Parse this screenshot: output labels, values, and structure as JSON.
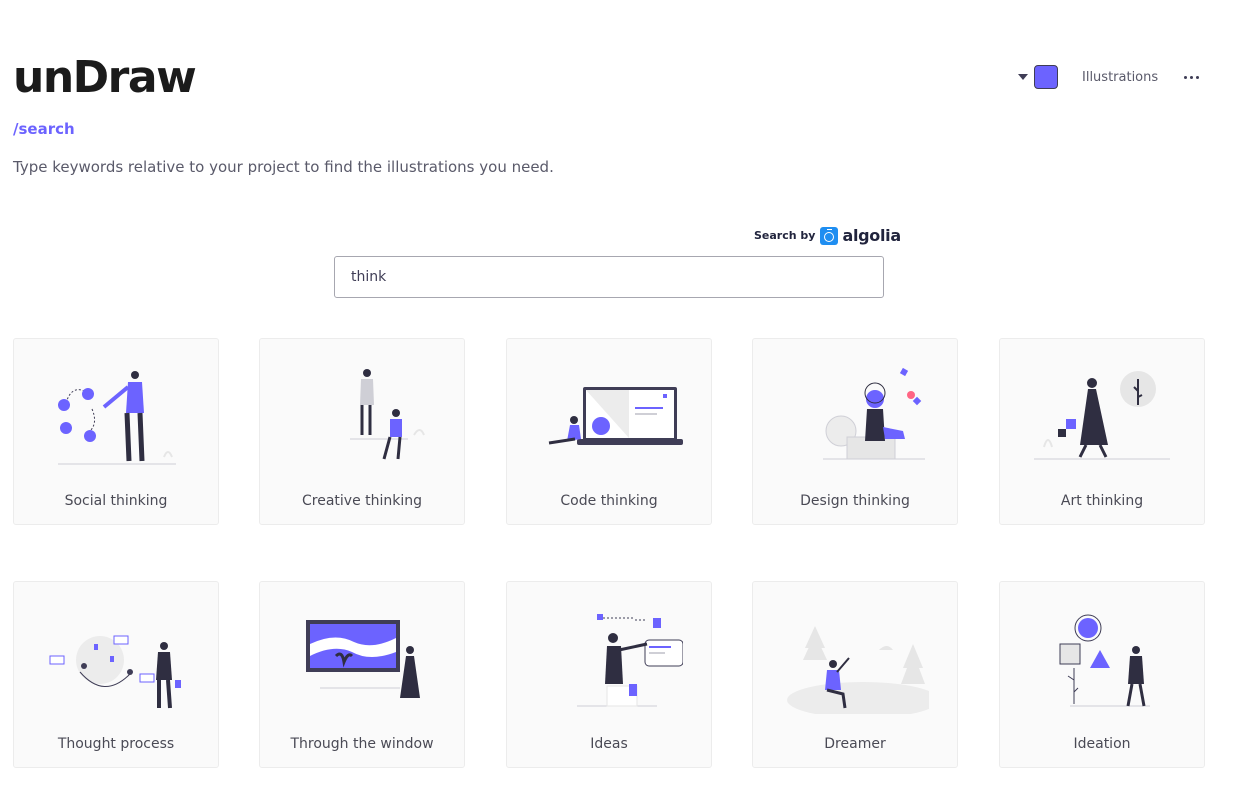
{
  "header": {
    "logo": "unDraw",
    "route": "/search",
    "tagline": "Type keywords relative to your project to find the illustrations you need."
  },
  "nav": {
    "accent_color": "#6c63ff",
    "illustrations_label": "Illustrations"
  },
  "search": {
    "value": "think",
    "provider_prefix": "Search by",
    "provider_name": "algolia"
  },
  "results": [
    {
      "title": "Social thinking",
      "icon": "illustration-social-thinking"
    },
    {
      "title": "Creative thinking",
      "icon": "illustration-creative-thinking"
    },
    {
      "title": "Code thinking",
      "icon": "illustration-code-thinking"
    },
    {
      "title": "Design thinking",
      "icon": "illustration-design-thinking"
    },
    {
      "title": "Art thinking",
      "icon": "illustration-art-thinking"
    },
    {
      "title": "Thought process",
      "icon": "illustration-thought-process"
    },
    {
      "title": "Through the window",
      "icon": "illustration-through-the-window"
    },
    {
      "title": "Ideas",
      "icon": "illustration-ideas"
    },
    {
      "title": "Dreamer",
      "icon": "illustration-dreamer"
    },
    {
      "title": "Ideation",
      "icon": "illustration-ideation"
    }
  ]
}
